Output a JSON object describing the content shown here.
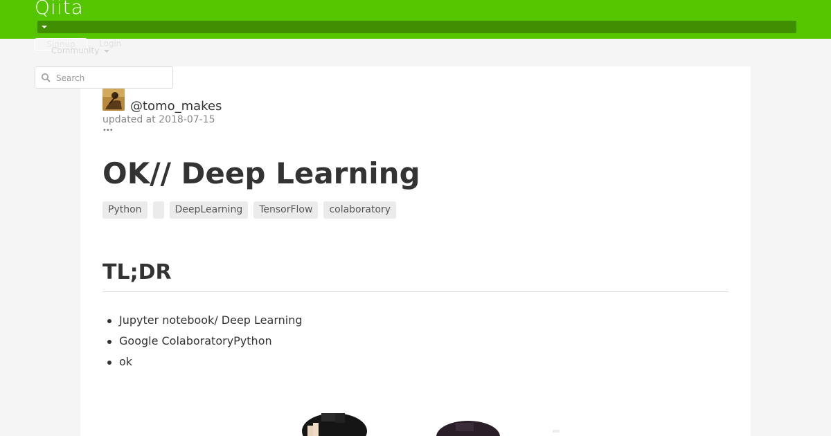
{
  "header": {
    "logo": "Qiita",
    "signup_label": "Signup",
    "login_label": "Login",
    "community_label": "Community"
  },
  "search": {
    "placeholder": "Search"
  },
  "article": {
    "author": "@tomo_makes",
    "updated": "updated at 2018-07-15",
    "more": "•••",
    "title": "OK// Deep Learning",
    "tags": [
      "Python",
      "",
      "DeepLearning",
      "TensorFlow",
      "colaboratory"
    ],
    "section_heading": "TL;DR",
    "bullets": [
      "Jupyter notebook/ Deep Learning",
      "Google ColaboratoryPython",
      "ok"
    ]
  },
  "colors": {
    "brand": "#55c500",
    "brand_dark": "#3f8f00",
    "tag_bg": "#ebebeb"
  }
}
